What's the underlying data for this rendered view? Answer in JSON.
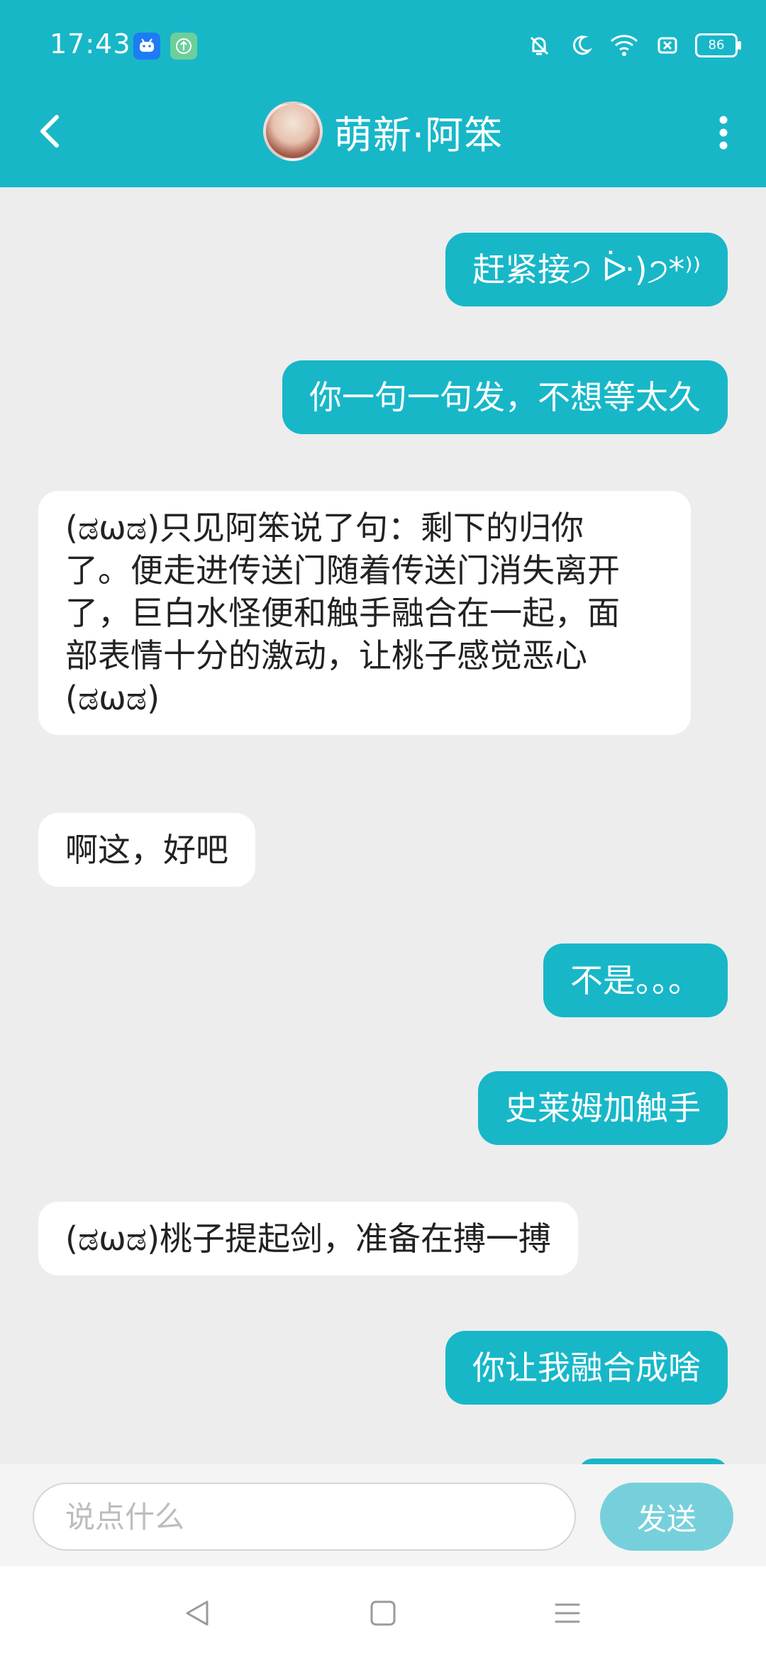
{
  "status_bar": {
    "time": "17:43",
    "battery": "86",
    "icons": [
      "android-icon",
      "upload-icon",
      "vibrate-off-icon",
      "moon-icon",
      "wifi-icon",
      "close-box-icon",
      "battery-icon"
    ]
  },
  "header": {
    "title": "萌新·阿笨",
    "back_icon": "chevron-left-icon",
    "more_icon": "more-vertical-icon",
    "colors": {
      "accent": "#17b7c8"
    }
  },
  "messages": [
    {
      "side": "out",
      "text": "赶紧接੭ ᐕ)੭*⁾⁾"
    },
    {
      "side": "out",
      "text": "你一句一句发，不想等太久"
    },
    {
      "side": "in",
      "text": "(ಡωಡ)只见阿笨说了句：剩下的归你\n了。便走进传送门随着传送门消失离开\n了，巨白水怪便和触手融合在一起，面\n部表情十分的激动，让桃子感觉恶心\n(ಡωಡ)"
    },
    {
      "side": "in",
      "text": "啊这，好吧"
    },
    {
      "side": "out",
      "text": "不是。。。"
    },
    {
      "side": "out",
      "text": "史莱姆加触手"
    },
    {
      "side": "in",
      "text": "(ಡωಡ)桃子提起剑，准备在搏一搏"
    },
    {
      "side": "out",
      "text": "你让我融合成啥"
    }
  ],
  "input": {
    "placeholder": "说点什么",
    "value": "",
    "send_label": "发送"
  },
  "navbar": {
    "icons": [
      "nav-back-icon",
      "nav-home-icon",
      "nav-menu-icon"
    ]
  }
}
